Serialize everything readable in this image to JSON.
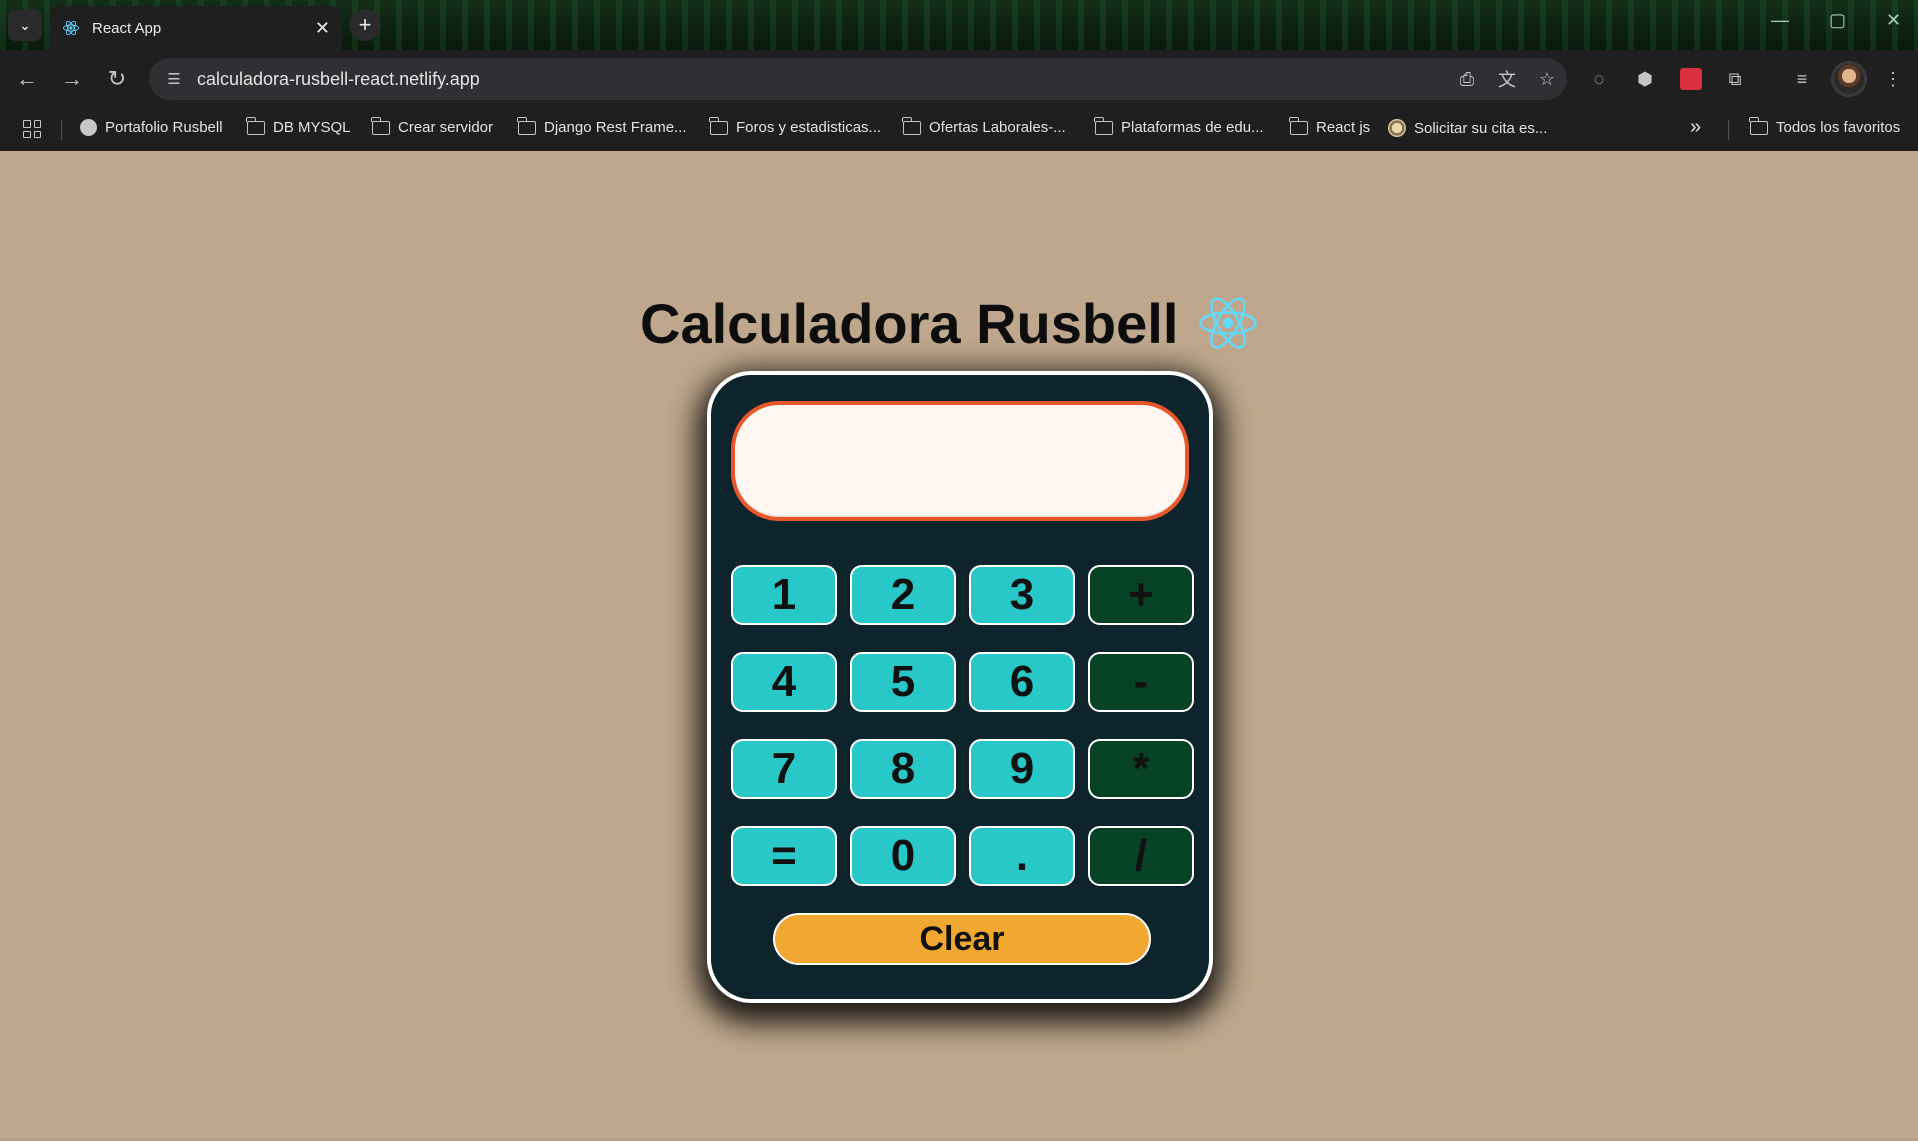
{
  "browser": {
    "tab": {
      "title": "React App"
    },
    "address_bar": {
      "url": "calculadora-rusbell-react.netlify.app"
    },
    "bookmarks": [
      {
        "label": "Portafolio Rusbell",
        "icon": "globe-icon"
      },
      {
        "label": "DB MYSQL",
        "icon": "folder-icon"
      },
      {
        "label": "Crear servidor",
        "icon": "folder-icon"
      },
      {
        "label": "Django Rest Frame...",
        "icon": "folder-icon"
      },
      {
        "label": "Foros y estadisticas...",
        "icon": "folder-icon"
      },
      {
        "label": "Ofertas Laborales-...",
        "icon": "folder-icon"
      },
      {
        "label": "Plataformas de edu...",
        "icon": "folder-icon"
      },
      {
        "label": "React js",
        "icon": "folder-icon"
      },
      {
        "label": "Solicitar su cita es...",
        "icon": "seal-icon"
      }
    ],
    "overflow_label": "»",
    "all_bookmarks": "Todos los favoritos"
  },
  "page": {
    "title": "Calculadora Rusbell",
    "display_value": "",
    "buttons": {
      "b1": "1",
      "b2": "2",
      "b3": "3",
      "plus": "+",
      "b4": "4",
      "b5": "5",
      "b6": "6",
      "minus": "-",
      "b7": "7",
      "b8": "8",
      "b9": "9",
      "times": "*",
      "equals": "=",
      "b0": "0",
      "dot": ".",
      "divide": "/"
    },
    "clear_label": "Clear"
  },
  "colors": {
    "page_bg": "#bea78c",
    "calculator_bg": "#0d242c",
    "number_button": "#29c8c8",
    "operator_button": "#064324",
    "clear_button": "#f0a830",
    "display_border": "#e8572a",
    "react_logo": "#61dafb"
  }
}
